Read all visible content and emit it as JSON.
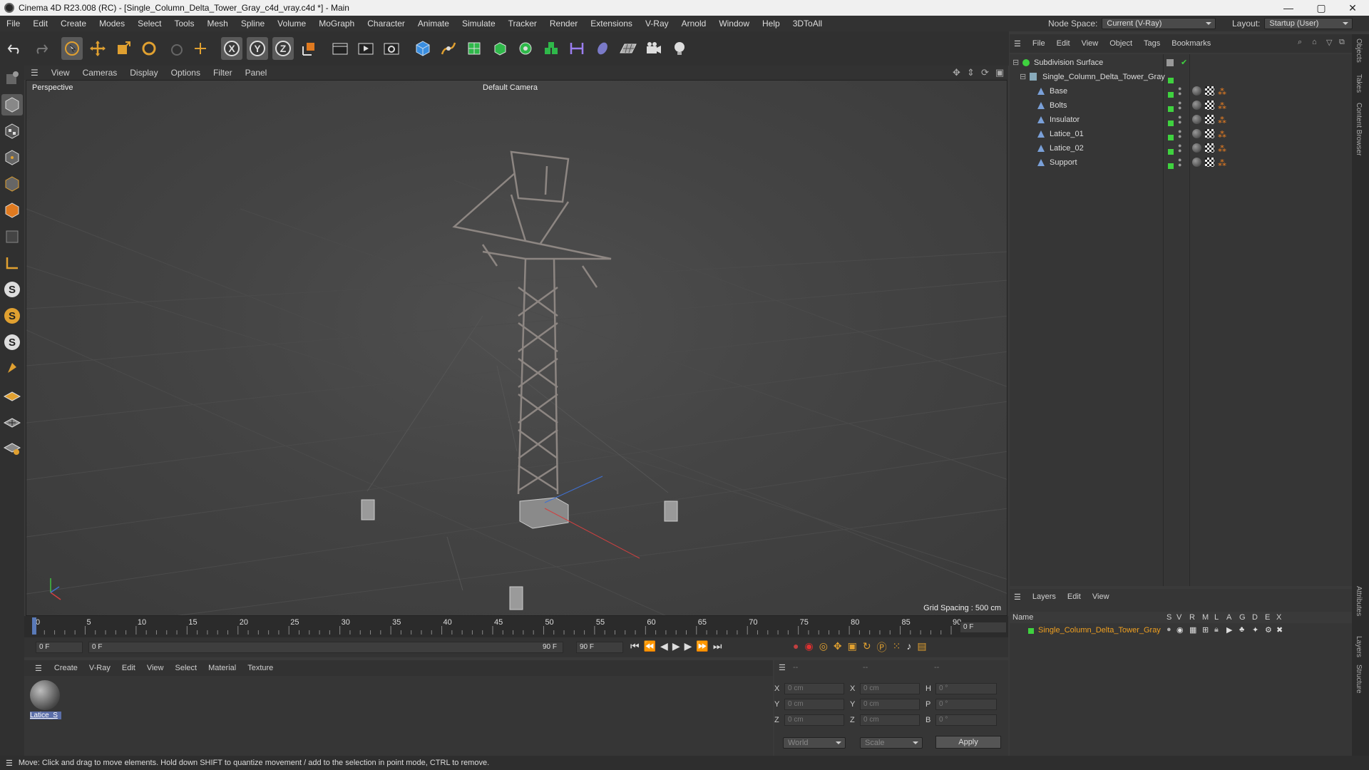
{
  "title": "Cinema 4D R23.008 (RC) - [Single_Column_Delta_Tower_Gray_c4d_vray.c4d *] - Main",
  "window_controls": {
    "minimize": "—",
    "maximize": "▢",
    "close": "✕"
  },
  "menu": [
    "File",
    "Edit",
    "Create",
    "Modes",
    "Select",
    "Tools",
    "Mesh",
    "Spline",
    "Volume",
    "MoGraph",
    "Character",
    "Animate",
    "Simulate",
    "Tracker",
    "Render",
    "Extensions",
    "V-Ray",
    "Arnold",
    "Window",
    "Help",
    "3DToAll"
  ],
  "node_space": {
    "label": "Node Space:",
    "value": "Current (V-Ray)"
  },
  "layout": {
    "label": "Layout:",
    "value": "Startup (User)"
  },
  "viewport_menu": [
    "View",
    "Cameras",
    "Display",
    "Options",
    "Filter",
    "Panel"
  ],
  "viewport": {
    "name": "Perspective",
    "camera": "Default Camera",
    "grid_spacing": "Grid Spacing : 500 cm"
  },
  "timeline": {
    "ticks": [
      "0",
      "5",
      "10",
      "15",
      "20",
      "25",
      "30",
      "35",
      "40",
      "45",
      "50",
      "55",
      "60",
      "65",
      "70",
      "75",
      "80",
      "85",
      "90"
    ],
    "current_frame": "0 F"
  },
  "transport": {
    "start": "0 F",
    "range_start": "0 F",
    "range_end": "90 F",
    "end": "90 F"
  },
  "material_menu": [
    "Create",
    "V-Ray",
    "Edit",
    "View",
    "Select",
    "Material",
    "Texture"
  ],
  "material": {
    "name": "Latice_S"
  },
  "coords": {
    "header": [
      "--",
      "--",
      "--"
    ],
    "rows": [
      {
        "l1": "X",
        "v1": "0 cm",
        "l2": "X",
        "v2": "0 cm",
        "l3": "H",
        "v3": "0 °"
      },
      {
        "l1": "Y",
        "v1": "0 cm",
        "l2": "Y",
        "v2": "0 cm",
        "l3": "P",
        "v3": "0 °"
      },
      {
        "l1": "Z",
        "v1": "0 cm",
        "l2": "Z",
        "v2": "0 cm",
        "l3": "B",
        "v3": "0 °"
      }
    ],
    "space": "World",
    "mode": "Scale",
    "apply": "Apply"
  },
  "object_menu": [
    "File",
    "Edit",
    "View",
    "Object",
    "Tags",
    "Bookmarks"
  ],
  "objects": {
    "root": "Subdivision Surface",
    "group": "Single_Column_Delta_Tower_Gray",
    "children": [
      "Base",
      "Bolts",
      "Insulator",
      "Latice_01",
      "Latice_02",
      "Support"
    ]
  },
  "layers_menu": [
    "Layers",
    "Edit",
    "View"
  ],
  "layers_columns": [
    "Name",
    "S",
    "V",
    "R",
    "M",
    "L",
    "A",
    "G",
    "D",
    "E",
    "X"
  ],
  "layer": {
    "name": "Single_Column_Delta_Tower_Gray",
    "color": "#3fd23f"
  },
  "right_tabs": [
    "Objects",
    "Takes",
    "Content Browser",
    "Attributes",
    "Layers",
    "Structure"
  ],
  "status": "Move: Click and drag to move elements. Hold down SHIFT to quantize movement / add to the selection in point mode, CTRL to remove.",
  "colors": {
    "accent": "#f0a020",
    "green": "#3fd23f",
    "layer_text": "#f0a020"
  }
}
